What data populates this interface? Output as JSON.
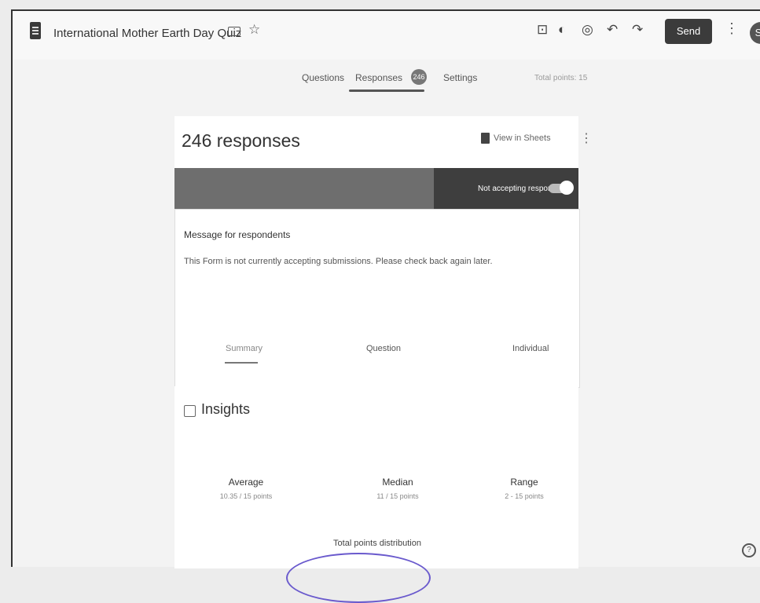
{
  "header": {
    "title": "International Mother Earth Day Quiz",
    "send_label": "Send",
    "avatar_initial": "S",
    "toolbar_icons": [
      "customize-theme-icon",
      "palette-icon",
      "preview-icon",
      "undo-icon",
      "redo-icon"
    ]
  },
  "tabs": {
    "questions": "Questions",
    "responses": "Responses",
    "responses_badge": "246",
    "settings": "Settings",
    "total_points": "Total points: 15"
  },
  "responses_card": {
    "title": "246 responses",
    "view_in_sheets": "View in Sheets",
    "accept_toggle_label": "Not accepting responses",
    "message_label": "Message for respondents",
    "message_text": "This Form is not currently accepting submissions. Please check back again later."
  },
  "subtabs": {
    "summary": "Summary",
    "question": "Question",
    "individual": "Individual"
  },
  "insights": {
    "title": "Insights",
    "average_label": "Average",
    "average_value": "10.35 / 15 points",
    "median_label": "Median",
    "median_value": "11 / 15 points",
    "range_label": "Range",
    "range_value": "2 - 15 points",
    "distribution_label": "Total points distribution"
  },
  "colors": {
    "send_button": "#3b3b3b",
    "accept_bar": "#6e6e6e",
    "accept_bar_dark": "#3e3e3e",
    "stamp": "#6a5acd"
  }
}
